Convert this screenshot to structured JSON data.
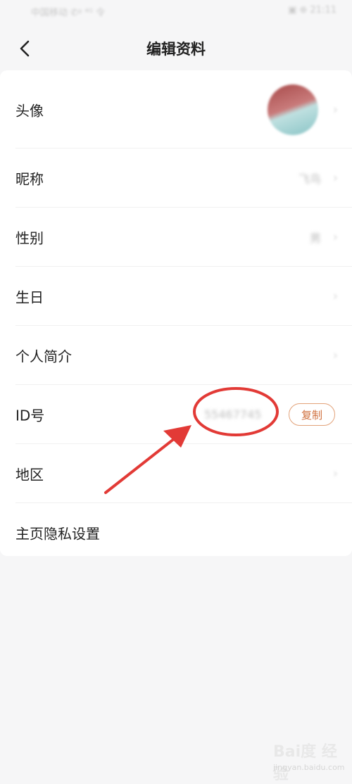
{
  "status_bar": {
    "left": "中国移动 ✆ᵍ ⁴ᴳ 令",
    "right": "▣ ⊕ 21:11"
  },
  "nav": {
    "title": "编辑资料"
  },
  "rows": [
    {
      "label": "头像"
    },
    {
      "label": "昵称",
      "value": "飞鸟"
    },
    {
      "label": "性别",
      "value": "男"
    },
    {
      "label": "生日"
    },
    {
      "label": "个人简介"
    },
    {
      "label": "ID号",
      "value": "55467745",
      "action": "复制"
    },
    {
      "label": "地区"
    },
    {
      "label": "主页隐私设置"
    }
  ],
  "watermark": {
    "logo": "Bai度 经验",
    "sub": "jingyan.baidu.com"
  }
}
